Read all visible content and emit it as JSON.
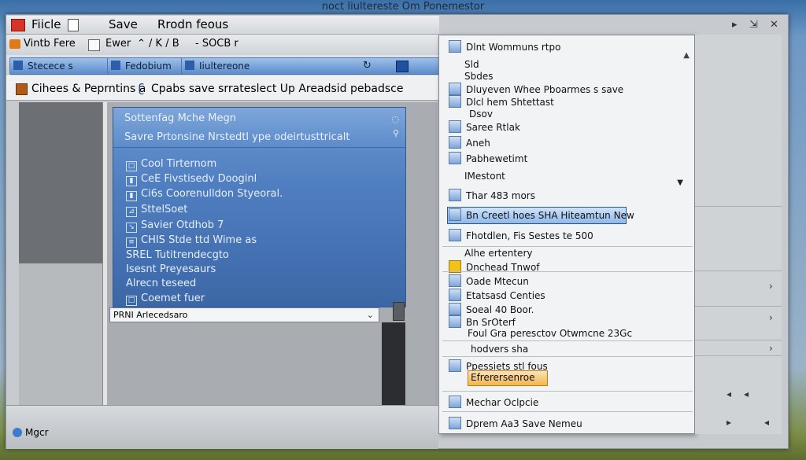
{
  "window_title": "noct Iiultereste Om Ponemestor",
  "window_controls": [
    "▸",
    "⇲",
    "✕"
  ],
  "menu": {
    "items": [
      "Fiicle",
      "Save",
      "Rrodn feous"
    ]
  },
  "toolbar": {
    "left_label": "Vintb Fere",
    "mid_label": "Ewer",
    "extra": "⌃ / K / B",
    "right_label": "- SOCB r"
  },
  "tabs": [
    "Stecece s",
    "Fedobium",
    "Iiultereone"
  ],
  "address": {
    "prefix": "Cihees & Peprntins a",
    "text": "Cpabs save srrateslect Up Areadsid pebadsce"
  },
  "popup": {
    "header_lines": [
      "Sottenfag Mche Megn",
      "Savre Prtonsine Nrstedtl ype odeirtusttricalt"
    ],
    "items": [
      {
        "icon": "□",
        "label": "Cool Tirternom"
      },
      {
        "icon": "▮",
        "label": "CeE Fivstisedv Dooginl"
      },
      {
        "icon": "▮",
        "label": "Ci6s Coorenulldon Styeoral."
      },
      {
        "icon": "⊿",
        "label": "SttelSoet"
      },
      {
        "icon": "↘",
        "label": "Savier Otdhob 7"
      },
      {
        "icon": "≡",
        "label": "CHIS Stde ttd Wime as"
      },
      {
        "icon": "",
        "label": "SREL Tutitrendecgto"
      },
      {
        "icon": "",
        "label": "Isesnt Preyesaurs"
      },
      {
        "icon": "",
        "label": "Alrecn teseed"
      },
      {
        "icon": "□",
        "label": "Coemet fuer"
      }
    ],
    "combo_value": "PRNI Arlecedsaro"
  },
  "context_menu": {
    "items": [
      {
        "label": "Dlnt Wommuns rtpo",
        "icon": true
      },
      {
        "label": "Sld",
        "icon": false
      },
      {
        "label": "Sbdes",
        "icon": false
      },
      {
        "label": "Dluyeven Whee Pboarmes s save",
        "icon": true
      },
      {
        "label": "Dlcl hem Shtettast",
        "icon": true
      },
      {
        "label": "Dsov",
        "icon": false
      },
      {
        "label": "Saree Rtlak",
        "icon": true
      },
      {
        "label": "Aneh",
        "icon": true
      },
      {
        "label": "Pabhewetimt",
        "icon": true
      },
      {
        "label": "IMestont",
        "icon": false
      },
      {
        "label": "Thar 483 mors",
        "icon": true
      },
      {
        "label": "Bn Creetl hoes SHA Hiteamtun New",
        "icon": true,
        "highlight": true
      },
      {
        "label": "Fhotdlen, Fis Sestes te 500",
        "icon": true
      },
      {
        "label": "Alhe ertentery",
        "icon": true
      },
      {
        "label": "Dnchead Tnwof",
        "icon": false
      },
      {
        "label": "Oade Mtecun",
        "icon": true
      },
      {
        "label": "Etatsasd Centies",
        "icon": true
      },
      {
        "label": "Soeal 40 Boor.",
        "icon": true
      },
      {
        "label": "Bn SrOterf",
        "icon": true
      },
      {
        "label": "Foul Gra peresctov Otwmcne 23Gc",
        "icon": false
      },
      {
        "label": "hodvers sha",
        "icon": false
      },
      {
        "label": "Ppessiets stl fous",
        "icon": true
      },
      {
        "label": "Efrerersenroe",
        "icon": false,
        "highlight_orange": true
      },
      {
        "label": "Mechar Oclpcie",
        "icon": true
      },
      {
        "label": "Dprem Aa3 Save Nemeu",
        "icon": true
      }
    ]
  },
  "status": {
    "label": "Mgcr"
  }
}
